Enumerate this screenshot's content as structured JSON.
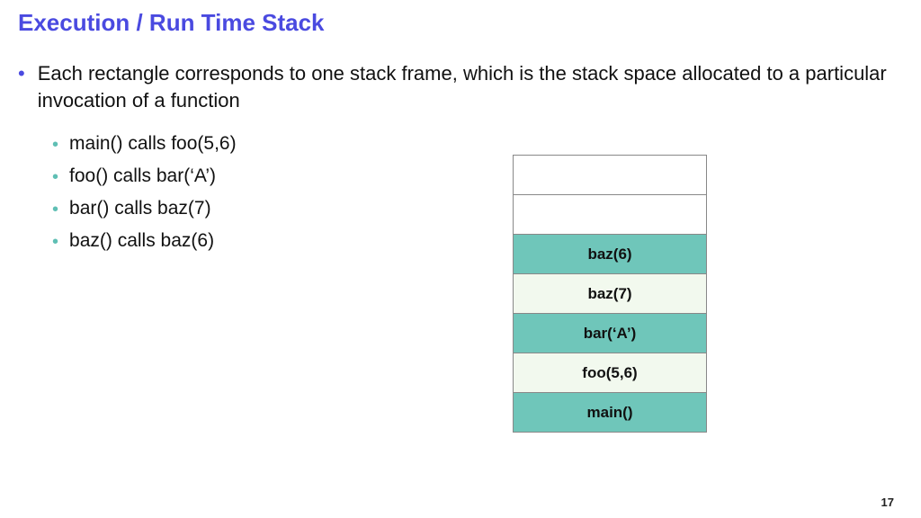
{
  "title": "Execution / Run Time Stack",
  "main_bullet": "Each rectangle corresponds to one stack frame, which is the stack space allocated to a particular invocation of a function",
  "sub_bullets": [
    "main() calls foo(5,6)",
    "foo() calls bar(‘A’)",
    "bar() calls baz(7)",
    "baz() calls baz(6)"
  ],
  "stack_frames": [
    {
      "label": "",
      "style": "empty"
    },
    {
      "label": "",
      "style": "empty"
    },
    {
      "label": "baz(6)",
      "style": "teal"
    },
    {
      "label": "baz(7)",
      "style": "pale"
    },
    {
      "label": "bar(‘A’)",
      "style": "teal"
    },
    {
      "label": "foo(5,6)",
      "style": "pale"
    },
    {
      "label": "main()",
      "style": "teal"
    }
  ],
  "page_number": "17"
}
